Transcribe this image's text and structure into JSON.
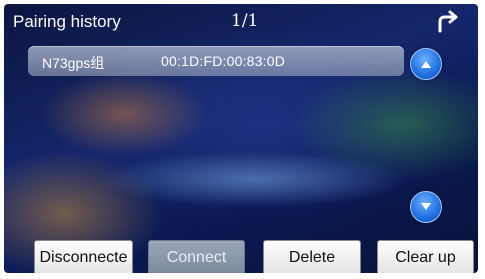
{
  "header": {
    "title": "Pairing history",
    "page_indicator": "1/1",
    "back_icon": "return-arrow-icon"
  },
  "devices": [
    {
      "name": "N73gps组",
      "address": "00:1D:FD:00:83:0D"
    }
  ],
  "scroll": {
    "up_icon": "chevron-up-icon",
    "down_icon": "chevron-down-icon"
  },
  "buttons": {
    "disconnect": "Disconnecte",
    "connect": "Connect",
    "delete": "Delete",
    "clear": "Clear up"
  },
  "colors": {
    "accent_blue": "#1f6fe0",
    "background_dark": "#0b1640",
    "button_disabled": "#8d99ab"
  }
}
